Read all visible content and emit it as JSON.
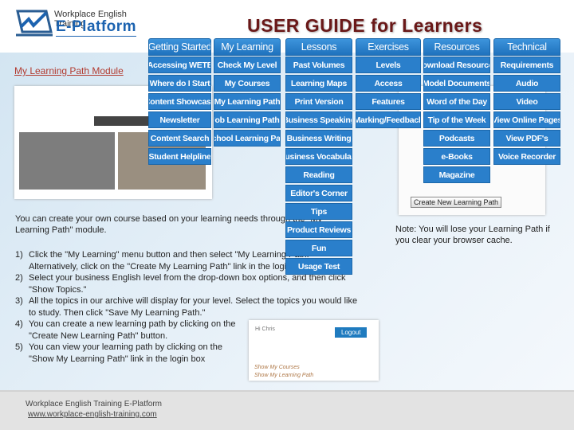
{
  "header": {
    "logo_line1": "Workplace English Training",
    "logo_line2": "E-Platform",
    "title": "USER GUIDE for Learners"
  },
  "module_title": "My Learning Path Module",
  "menus": [
    {
      "label": "Getting Started",
      "items": [
        "Accessing WETE",
        "Where do I Start",
        "Content Showcase",
        "Newsletter",
        "Content Search",
        "Student Helpline"
      ]
    },
    {
      "label": "My Learning",
      "items": [
        "Check My Level",
        "My Courses",
        "My Learning Path",
        "Job Learning Paths",
        "School Learning Path"
      ]
    },
    {
      "label": "Lessons",
      "items": [
        "Past Volumes",
        "Learning Maps",
        "Print Version",
        "Business Speaking",
        "Business Writing",
        "Business Vocabulary",
        "Reading",
        "Editor's Corner",
        "Tips",
        "Product Reviews",
        "Fun",
        "Usage Test"
      ]
    },
    {
      "label": "Exercises",
      "items": [
        "Levels",
        "Access",
        "Features",
        "Marking/Feedback"
      ]
    },
    {
      "label": "Resources",
      "items": [
        "Download Resources",
        "Model Documents",
        "Word of the Day",
        "Tip of the Week",
        "Podcasts",
        "e-Books",
        "Magazine"
      ]
    },
    {
      "label": "Technical",
      "items": [
        "Requirements",
        "Audio",
        "Video",
        "View Online Pages",
        "View PDF's",
        "Voice Recorder"
      ]
    }
  ],
  "intro": "You can create your own course based on your learning needs through the \"My Learning Path\" module.",
  "steps": [
    {
      "n": "1)",
      "text": "Click the \"My Learning\" menu button and then select \"My Learning Path.\" Alternatively, click on the \"Create My Learning Path\" link in the login box."
    },
    {
      "n": "2)",
      "text": "Select your business English level from the drop-down box options, and then click \"Show Topics.\""
    },
    {
      "n": "3)",
      "text": "All the topics in our archive will display for your level. Select the topics you would like to study. Then click \"Save My Learning Path.\""
    },
    {
      "n": "4)",
      "text": "You can create a new learning path by clicking on the \"Create New Learning Path\" button."
    },
    {
      "n": "5)",
      "text": "You can view your learning path by clicking on the \"Show My Learning Path\" link in the login box"
    }
  ],
  "note": "Note: You will lose your Learning Path if you clear your browser cache.",
  "screenshot": {
    "create_button": "Create New Learning Path",
    "hi": "Hi Chris",
    "logout": "Logout",
    "show_courses": "Show My Courses",
    "show_path": "Show My Learning Path"
  },
  "footer": {
    "name": "Workplace English Training E-Platform",
    "url": "www.workplace-english-training.com"
  },
  "colors": {
    "menu": "#2a7fcb",
    "title": "#6a1818",
    "module_title": "#b23b30"
  }
}
